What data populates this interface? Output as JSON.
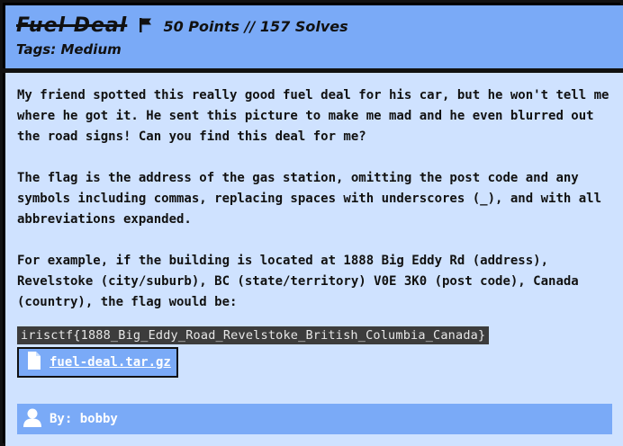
{
  "challenge": {
    "title": "Fuel Deal",
    "points": "50 Points // 157 Solves",
    "tags": "Tags: Medium",
    "description": [
      "My friend spotted this really good fuel deal for his car, but he won't tell me where he got it. He sent this picture to make me mad and he even blurred out the road signs! Can you find this deal for me?",
      "The flag is the address of the gas station, omitting the post code and any symbols including commas, replacing spaces with underscores (_), and with all abbreviations expanded.",
      "For example, if the building is located at 1888 Big Eddy Rd (address), Revelstoke (city/suburb), BC (state/territory) V0E 3K0 (post code), Canada (country), the flag would be:"
    ],
    "example_flag": "irisctf{1888_Big_Eddy_Road_Revelstoke_British_Columbia_Canada}",
    "attachment": "fuel-deal.tar.gz",
    "author": "By: bobby"
  },
  "colors": {
    "header_bg": "#7aaaf7",
    "body_bg": "#cfe2ff",
    "code_bg": "#3c3c3c"
  }
}
